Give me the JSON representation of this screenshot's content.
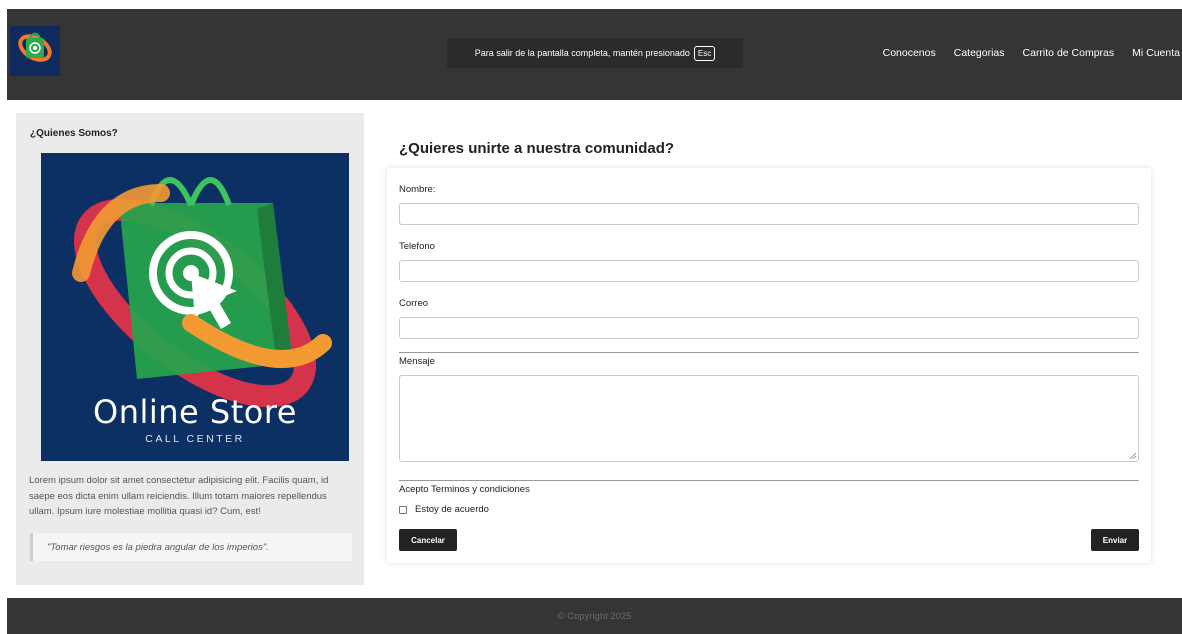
{
  "header": {
    "logo_text": "Online Store",
    "fullscreen_notice": "Para salir de la pantalla completa, mantén presionado",
    "esc_key": "Esc",
    "nav": [
      "Conocenos",
      "Categorias",
      "Carrito de Compras",
      "Mi Cuenta"
    ]
  },
  "sidebar": {
    "title": "¿Quienes Somos?",
    "hero_title": "Online Store",
    "hero_subtitle": "CALL CENTER",
    "paragraph": "Lorem ipsum dolor sit amet consectetur adipisicing elit. Facilis quam, id saepe eos dicta enim ullam reiciendis. Illum totam maiores repellendus ullam. Ipsum iure molestiae mollitia quasi id? Cum, est!",
    "quote": "\"Tomar riesgos es la piedra angular de los imperios\"."
  },
  "form": {
    "title": "¿Quieres unirte a nuestra comunidad?",
    "name_label": "Nombre:",
    "phone_label": "Telefono",
    "email_label": "Correo",
    "message_label": "Mensaje",
    "terms_label": "Acepto Terminos y condiciones",
    "agree_label": "Estoy de acuerdo",
    "cancel_label": "Cancelar",
    "submit_label": "Enviar"
  },
  "footer": {
    "copyright": "© Copyright 2025"
  },
  "colors": {
    "header_bg": "#353535",
    "button_bg": "#222222",
    "hero_bg": "#0c2f64"
  }
}
